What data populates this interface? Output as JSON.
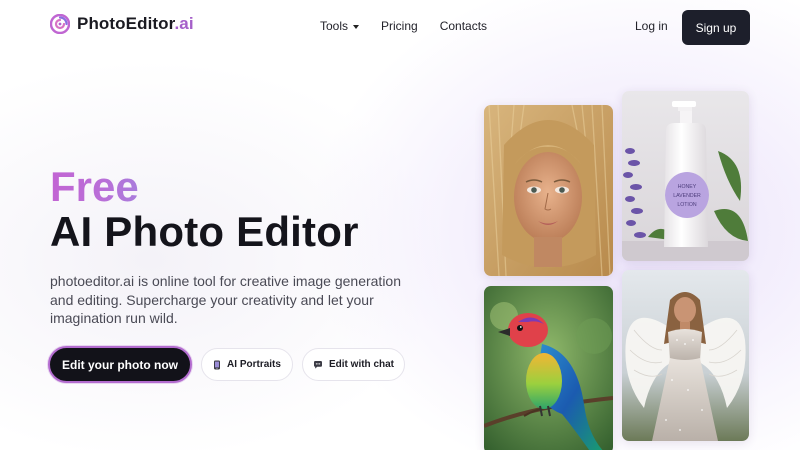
{
  "brand": {
    "name": "PhotoEditor",
    "suffix": ".ai",
    "accent_color": "#a55fc9",
    "logo_icon": "swirl-logo-icon"
  },
  "nav": {
    "tools": "Tools",
    "pricing": "Pricing",
    "contacts": "Contacts"
  },
  "auth": {
    "login": "Log in",
    "signup": "Sign up"
  },
  "hero": {
    "highlight": "Free",
    "title": "AI Photo Editor",
    "description": "photoeditor.ai is online tool for creative image generation and editing. Supercharge your creativity and let your imagination run wild."
  },
  "cta": {
    "primary": "Edit your photo now",
    "portraits": "AI Portraits",
    "portraits_icon": "phone-icon",
    "chat": "Edit with chat",
    "chat_icon": "chat-icon"
  },
  "gallery": {
    "bottle_label": [
      "HONEY",
      "LAVENDER",
      "LOTION"
    ]
  }
}
